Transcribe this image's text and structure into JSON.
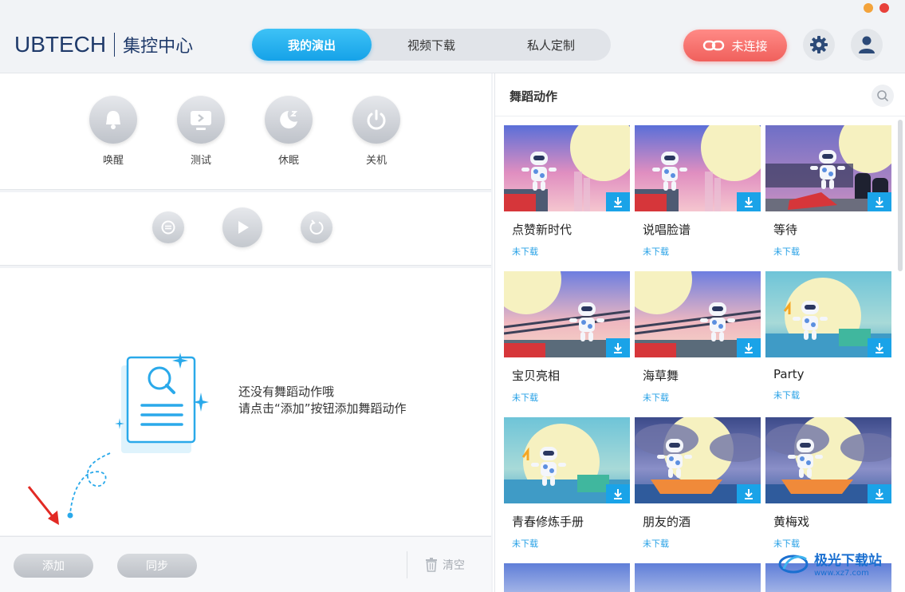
{
  "header": {
    "brand": "UBTECH",
    "title": "集控中心",
    "tabs": [
      {
        "label": "我的演出",
        "active": true
      },
      {
        "label": "视频下载",
        "active": false
      },
      {
        "label": "私人定制",
        "active": false
      }
    ],
    "connect_label": "未连接",
    "colors": {
      "accent": "#1aa3e8",
      "connect": "#f0605c"
    }
  },
  "controls": [
    {
      "label": "唤醒",
      "icon": "bell-icon"
    },
    {
      "label": "测试",
      "icon": "monitor-icon"
    },
    {
      "label": "休眠",
      "icon": "moon-icon"
    },
    {
      "label": "关机",
      "icon": "power-icon"
    }
  ],
  "playback": [
    "loop-icon",
    "play-icon",
    "reset-icon"
  ],
  "empty_state": {
    "line1": "还没有舞蹈动作哦",
    "line2": "请点击“添加”按钮添加舞蹈动作"
  },
  "footer": {
    "add_label": "添加",
    "sync_label": "同步",
    "clear_label": "清空"
  },
  "library": {
    "title": "舞蹈动作",
    "items": [
      {
        "title": "点赞新时代",
        "status": "未下载",
        "scene": "moon"
      },
      {
        "title": "说唱脸谱",
        "status": "未下载",
        "scene": "moon"
      },
      {
        "title": "等待",
        "status": "未下载",
        "scene": "city"
      },
      {
        "title": "宝贝亮相",
        "status": "未下载",
        "scene": "fence"
      },
      {
        "title": "海草舞",
        "status": "未下载",
        "scene": "fence"
      },
      {
        "title": "Party",
        "status": "未下载",
        "scene": "sea"
      },
      {
        "title": "青春修炼手册",
        "status": "未下载",
        "scene": "sea"
      },
      {
        "title": "朋友的酒",
        "status": "未下载",
        "scene": "boat"
      },
      {
        "title": "黄梅戏",
        "status": "未下载",
        "scene": "boat"
      }
    ]
  },
  "watermark": {
    "name": "极光下载站",
    "url": "www.xz7.com"
  }
}
